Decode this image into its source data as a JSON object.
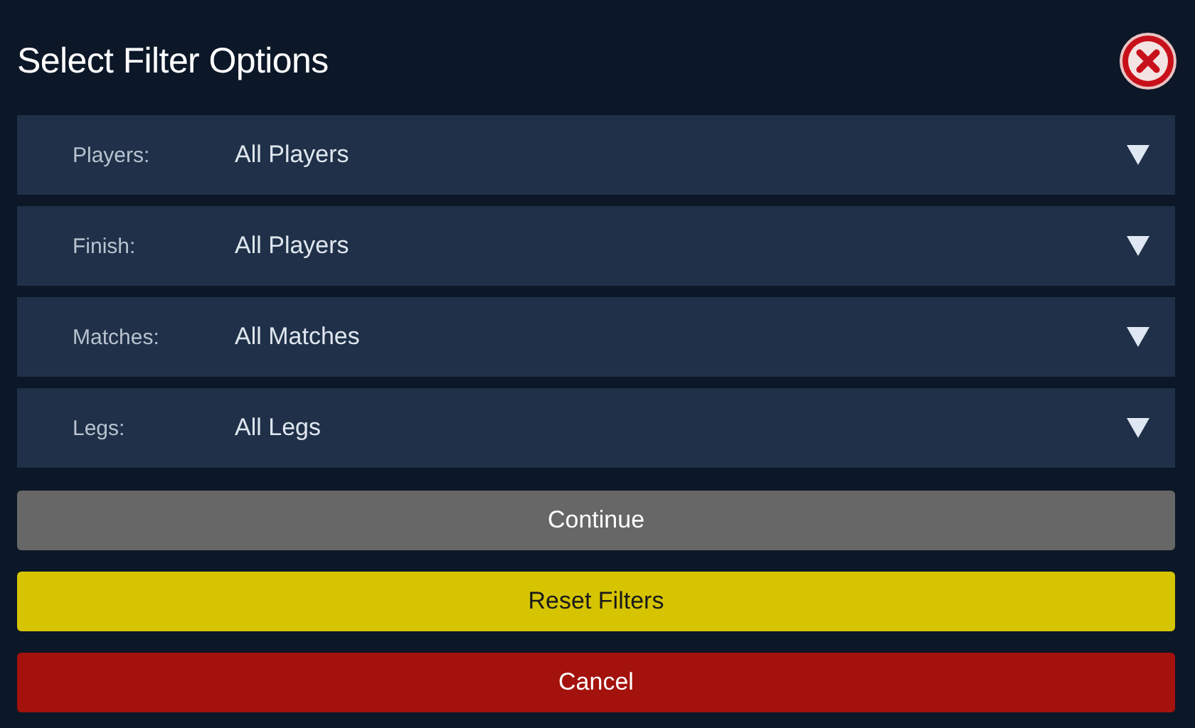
{
  "title": "Select Filter Options",
  "filters": [
    {
      "label": "Players:",
      "value": "All Players"
    },
    {
      "label": "Finish:",
      "value": "All Players"
    },
    {
      "label": "Matches:",
      "value": "All Matches"
    },
    {
      "label": "Legs:",
      "value": "All Legs"
    }
  ],
  "buttons": [
    {
      "label": "Continue",
      "kind": "neutral"
    },
    {
      "label": "Reset Filters",
      "kind": "warning"
    },
    {
      "label": "Cancel",
      "kind": "danger"
    }
  ]
}
